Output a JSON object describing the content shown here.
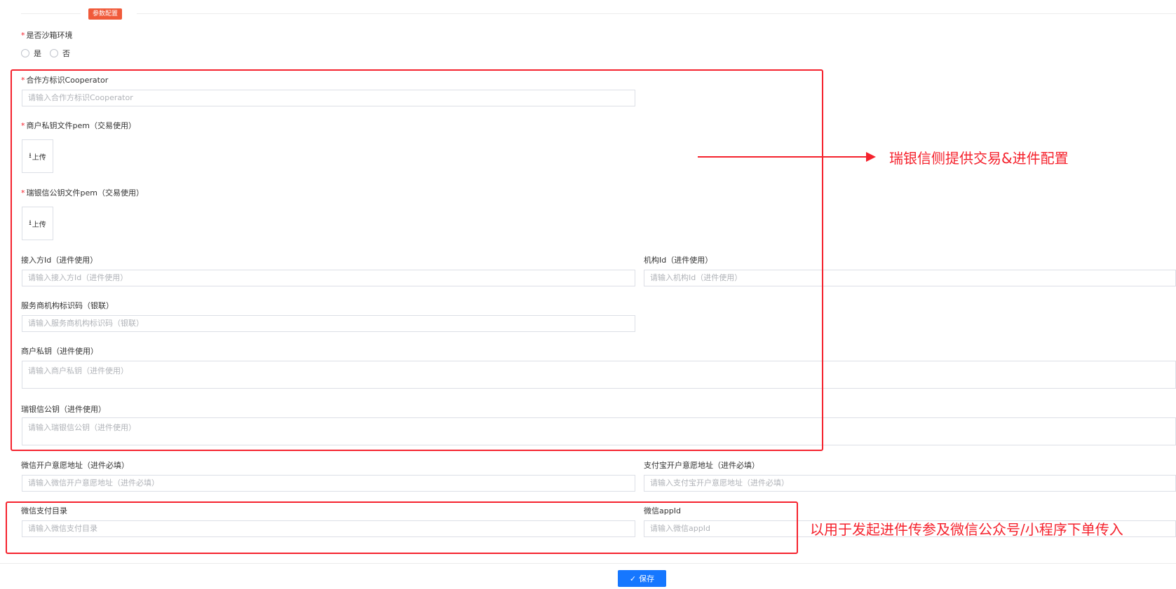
{
  "section": {
    "title": "参数配置"
  },
  "sandbox": {
    "label": "是否沙箱环境",
    "options": [
      "是",
      "否"
    ]
  },
  "cooperator": {
    "label": "合作方标识Cooperator",
    "placeholder": "请输入合作方标识Cooperator"
  },
  "merchant_key_file": {
    "label": "商户私钥文件pem（交易使用）",
    "upload_label": "上传"
  },
  "rbx_pubkey_file": {
    "label": "瑞银信公钥文件pem（交易使用）",
    "upload_label": "上传"
  },
  "access_id": {
    "label": "接入方Id（进件使用）",
    "placeholder": "请输入接入方Id（进件使用）"
  },
  "org_id": {
    "label": "机构Id（进件使用）",
    "placeholder": "请输入机构Id（进件使用）"
  },
  "provider_code": {
    "label": "服务商机构标识码（银联）",
    "placeholder": "请输入服务商机构标识码（银联）"
  },
  "merchant_private_key": {
    "label": "商户私钥（进件使用）",
    "placeholder": "请输入商户私钥（进件使用）"
  },
  "rbx_public_key": {
    "label": "瑞银信公钥（进件使用）",
    "placeholder": "请输入瑞银信公钥（进件使用）"
  },
  "wechat_intent_url": {
    "label": "微信开户意愿地址（进件必填）",
    "placeholder": "请输入微信开户意愿地址（进件必填）"
  },
  "alipay_intent_url": {
    "label": "支付宝开户意愿地址（进件必填）",
    "placeholder": "请输入支付宝开户意愿地址（进件必填）"
  },
  "wechat_pay_dir": {
    "label": "微信支付目录",
    "placeholder": "请输入微信支付目录"
  },
  "wechat_appid": {
    "label": "微信appId",
    "placeholder": "请输入微信appId"
  },
  "annotations": {
    "top": "瑞银信侧提供交易&进件配置",
    "bottom": "以用于发起进件传参及微信公众号/小程序下单传入"
  },
  "footer": {
    "save_label": "保存"
  },
  "colors": {
    "accent": "#1677ff",
    "annotation": "#f5222d",
    "badge": "#f05a3a"
  },
  "icons": {
    "upload": "upload-icon",
    "save": "check-icon"
  }
}
